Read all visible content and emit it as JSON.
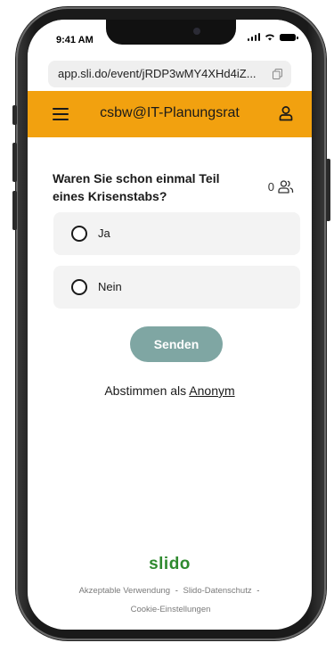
{
  "status_bar": {
    "time": "9:41 AM"
  },
  "browser": {
    "url": "app.sli.do/event/jRDP3wMY4XHd4iZ..."
  },
  "header": {
    "title": "csbw@IT-Planungsrat"
  },
  "poll": {
    "question": "Waren Sie schon einmal Teil eines Krisenstabs?",
    "participant_count": "0",
    "options": [
      {
        "label": "Ja"
      },
      {
        "label": "Nein"
      }
    ],
    "send_label": "Senden"
  },
  "anonymous": {
    "prefix": "Abstimmen als",
    "link": "Anonym"
  },
  "footer": {
    "brand": "slido",
    "links": [
      "Akzeptable Verwendung",
      "Slido-Datenschutz",
      "Cookie-Einstellungen"
    ],
    "separator": "-"
  },
  "colors": {
    "accent": "#f2a10f",
    "button": "#7fa6a3",
    "brand": "#2f8a2f"
  }
}
